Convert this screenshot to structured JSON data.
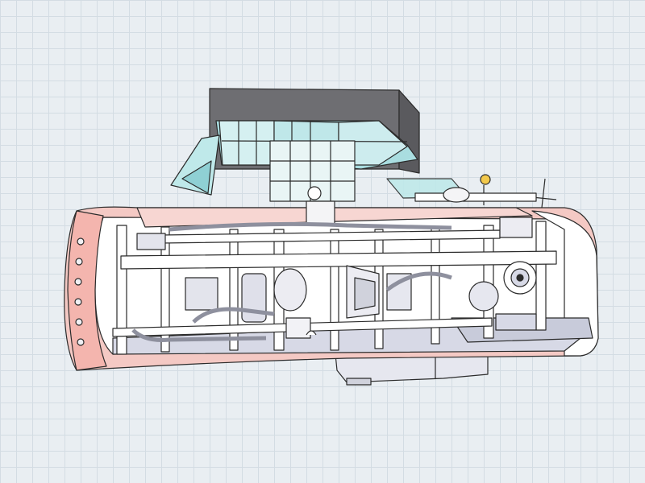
{
  "scene": {
    "subject": "cutaway-cad-model",
    "background_color": "#e9eef2",
    "grid_color": "#d3dce3",
    "colors": {
      "hull_outer": "#f4c9c4",
      "hull_edge": "#2b2b2b",
      "interior": "#ffffff",
      "interior_shadow": "#d7d9e6",
      "panel_gray": "#cfcfd6",
      "deck_block": "#6e6e72",
      "glass": "#a9dde0",
      "glass_light": "#d5f0f1",
      "accent_yellow": "#f2c94c"
    },
    "views": {
      "perspective": "isometric-right",
      "shading": "flat-with-outlines",
      "show_grid": true
    }
  }
}
